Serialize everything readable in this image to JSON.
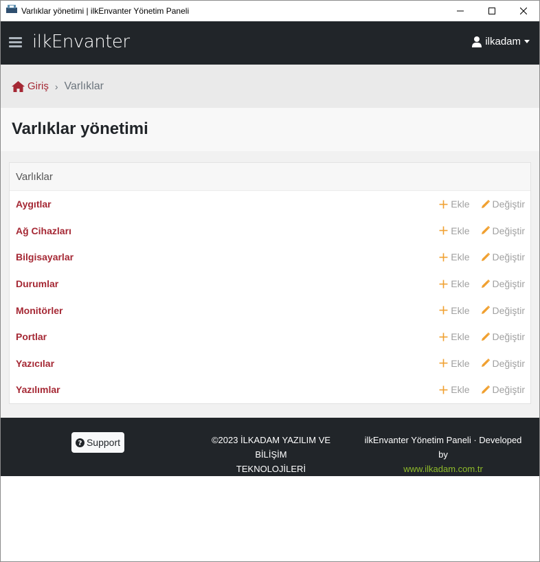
{
  "window": {
    "title": "Varlıklar yönetimi | ilkEnvanter Yönetim Paneli",
    "icons": [
      "app-icon",
      "minimize-icon",
      "maximize-icon",
      "close-icon"
    ]
  },
  "navbar": {
    "brand": "ilkEnvanter",
    "user": "ilkadam",
    "icons": [
      "hamburger-menu-icon",
      "user-icon",
      "caret-down-icon"
    ]
  },
  "breadcrumb": {
    "home": "Giriş",
    "separator": "›",
    "current": "Varlıklar"
  },
  "page": {
    "title": "Varlıklar yönetimi"
  },
  "card": {
    "header": "Varlıklar",
    "add_label": "Ekle",
    "change_label": "Değiştir",
    "items": [
      {
        "name": "Aygıtlar"
      },
      {
        "name": "Ağ Cihazları"
      },
      {
        "name": "Bilgisayarlar"
      },
      {
        "name": "Durumlar"
      },
      {
        "name": "Monitörler"
      },
      {
        "name": "Portlar"
      },
      {
        "name": "Yazıcılar"
      },
      {
        "name": "Yazılımlar"
      }
    ]
  },
  "footer": {
    "support_label": "Support",
    "copyright_line1": "©2023 İLKADAM YAZILIM VE BİLİŞİM",
    "copyright_line2": "TEKNOLOJİLERİ",
    "developed_by": "ilkEnvanter Yönetim Paneli · Developed by",
    "website": "www.ilkadam.com.tr"
  },
  "colors": {
    "navbar": "#212529",
    "accent": "#a52834",
    "action_icon": "#f0a030",
    "link_green": "#8fbc2a"
  }
}
